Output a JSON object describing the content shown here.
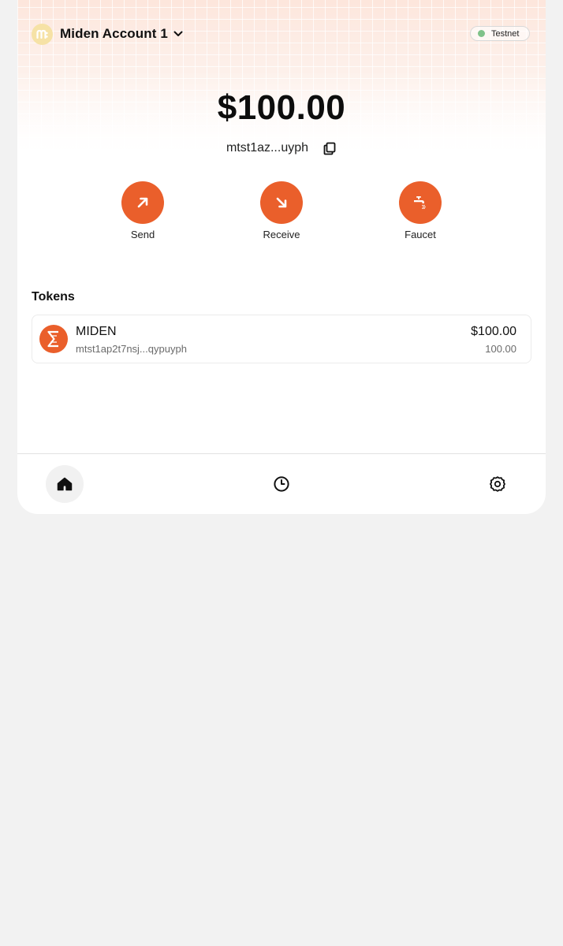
{
  "header": {
    "account_name": "Miden Account 1",
    "avatar_glyph": "m",
    "network_label": "Testnet",
    "network_status_color": "#7fc28a"
  },
  "wallet": {
    "balance": "$100.00",
    "address": "mtst1az...uyph"
  },
  "actions": [
    {
      "label": "Send",
      "icon": "arrow-up-right-icon"
    },
    {
      "label": "Receive",
      "icon": "arrow-down-right-icon"
    },
    {
      "label": "Faucet",
      "icon": "faucet-icon"
    }
  ],
  "tokens": {
    "title": "Tokens",
    "items": [
      {
        "name": "MIDEN",
        "address": "mtst1ap2t7nsj...qypuyph",
        "usd_value": "$100.00",
        "amount": "100.00",
        "icon": "miden-token-icon"
      }
    ]
  },
  "nav": {
    "items": [
      {
        "name": "home",
        "icon": "home-icon",
        "active": true
      },
      {
        "name": "history",
        "icon": "clock-icon",
        "active": false
      },
      {
        "name": "settings",
        "icon": "gear-icon",
        "active": false
      }
    ]
  },
  "colors": {
    "accent": "#ea5f2b",
    "background": "#f2f2f2",
    "card": "#ffffff",
    "avatar": "#f6e2a6"
  }
}
